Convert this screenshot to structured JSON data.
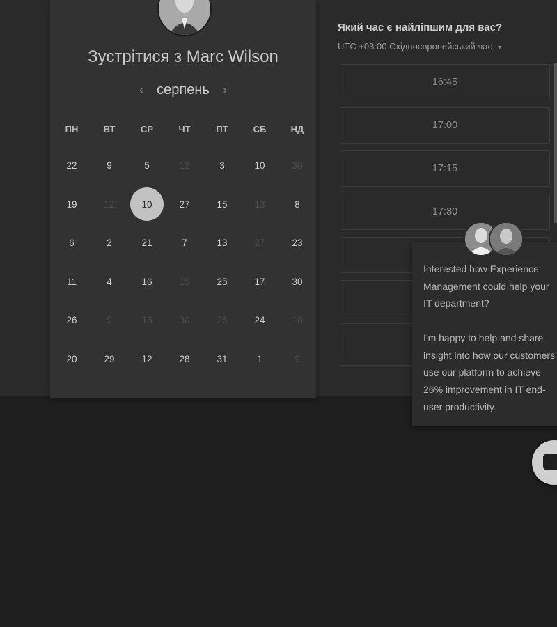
{
  "scheduler": {
    "title": "Зустрітися з Marc Wilson",
    "month": "серпень",
    "prev_arrow": "‹",
    "next_arrow": "›",
    "weekdays": [
      "ПН",
      "ВТ",
      "СР",
      "ЧТ",
      "ПТ",
      "СБ",
      "НД"
    ],
    "rows": [
      [
        {
          "d": "22",
          "dim": false
        },
        {
          "d": "9",
          "dim": false
        },
        {
          "d": "5",
          "dim": false
        },
        {
          "d": "12",
          "dim": true
        },
        {
          "d": "3",
          "dim": false
        },
        {
          "d": "10",
          "dim": false
        },
        {
          "d": "30",
          "dim": true
        }
      ],
      [
        {
          "d": "19",
          "dim": false
        },
        {
          "d": "12",
          "dim": true
        },
        {
          "d": "10",
          "dim": false,
          "selected": true
        },
        {
          "d": "27",
          "dim": false
        },
        {
          "d": "15",
          "dim": false
        },
        {
          "d": "13",
          "dim": true
        },
        {
          "d": "8",
          "dim": false
        }
      ],
      [
        {
          "d": "6",
          "dim": false
        },
        {
          "d": "2",
          "dim": false
        },
        {
          "d": "21",
          "dim": false
        },
        {
          "d": "7",
          "dim": false
        },
        {
          "d": "13",
          "dim": false
        },
        {
          "d": "27",
          "dim": true
        },
        {
          "d": "23",
          "dim": false
        }
      ],
      [
        {
          "d": "11",
          "dim": false
        },
        {
          "d": "4",
          "dim": false
        },
        {
          "d": "16",
          "dim": false
        },
        {
          "d": "15",
          "dim": true
        },
        {
          "d": "25",
          "dim": false
        },
        {
          "d": "17",
          "dim": false
        },
        {
          "d": "30",
          "dim": false
        }
      ],
      [
        {
          "d": "26",
          "dim": false
        },
        {
          "d": "9",
          "dim": true
        },
        {
          "d": "13",
          "dim": true
        },
        {
          "d": "30",
          "dim": true
        },
        {
          "d": "26",
          "dim": true
        },
        {
          "d": "24",
          "dim": false
        },
        {
          "d": "10",
          "dim": true
        }
      ],
      [
        {
          "d": "20",
          "dim": false
        },
        {
          "d": "29",
          "dim": false
        },
        {
          "d": "12",
          "dim": false
        },
        {
          "d": "28",
          "dim": false
        },
        {
          "d": "31",
          "dim": false
        },
        {
          "d": "1",
          "dim": false
        },
        {
          "d": "9",
          "dim": true
        }
      ]
    ]
  },
  "times": {
    "title": "Який час є найліпшим для вас?",
    "timezone": "UTC +03:00 Східноєвропейський час",
    "slots": [
      "16:45",
      "17:00",
      "17:15",
      "17:30",
      "",
      "",
      ""
    ]
  },
  "chat": {
    "message_1": "Interested how Experience Management could help your IT department?",
    "message_2": "I'm happy to help and share insight into how our customers use our platform to achieve 26% improvement in IT end-user productivity."
  }
}
